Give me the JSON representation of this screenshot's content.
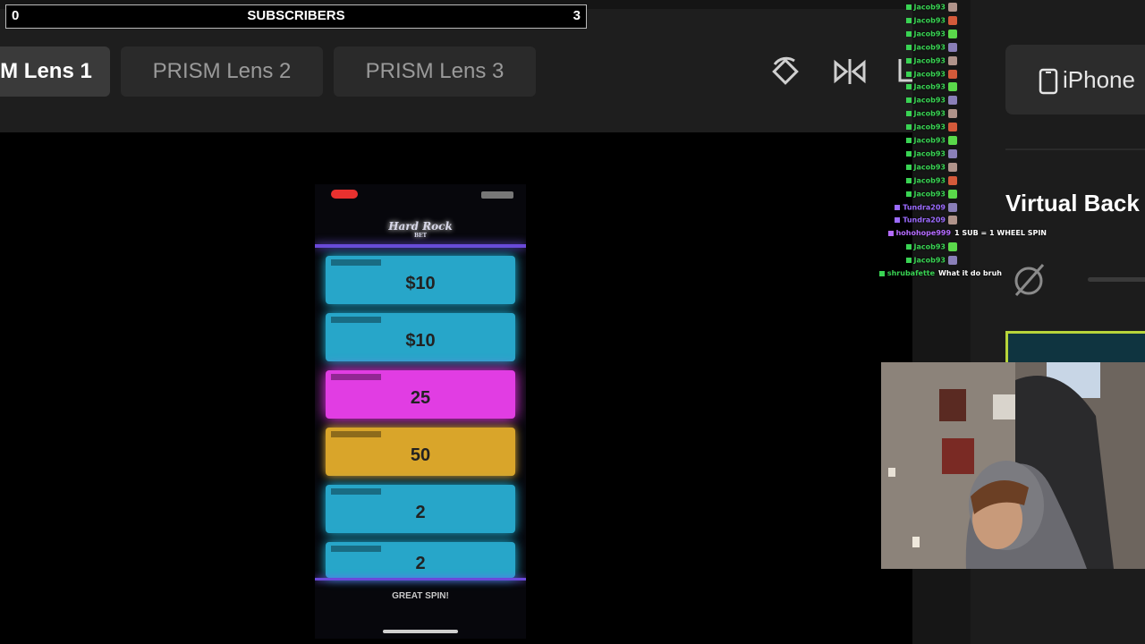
{
  "subscriber_bar": {
    "left_count": "0",
    "title": "SUBSCRIBERS",
    "right_count": "3"
  },
  "lens_tabs": [
    {
      "label": "M Lens 1",
      "active": true
    },
    {
      "label": "PRISM Lens 2",
      "active": false
    },
    {
      "label": "PRISM Lens 3",
      "active": false
    }
  ],
  "toolbar_icons": [
    "rotate-icon",
    "mirror-icon",
    "crop-icon"
  ],
  "right_panel": {
    "device_button": "iPhone",
    "device_icon": "phone-icon",
    "virtual_background_title": "Virtual Back",
    "no-bg-icon": "slashed-circle-icon"
  },
  "phone_screen": {
    "logo": "Hard Rock",
    "logo_sub": "BET",
    "cards": [
      {
        "value": "$10",
        "color": "teal"
      },
      {
        "value": "$10",
        "color": "teal"
      },
      {
        "value": "25",
        "color": "pink"
      },
      {
        "value": "50",
        "color": "gold"
      },
      {
        "value": "2",
        "color": "teal"
      },
      {
        "value": "2",
        "color": "teal"
      }
    ],
    "footer": "GREAT SPIN!"
  },
  "chat": [
    {
      "user": "Jacob93",
      "msg": "",
      "color": "#39d353"
    },
    {
      "user": "Jacob93",
      "msg": "",
      "color": "#39d353"
    },
    {
      "user": "Jacob93",
      "msg": "",
      "color": "#39d353"
    },
    {
      "user": "Jacob93",
      "msg": "",
      "color": "#39d353"
    },
    {
      "user": "Jacob93",
      "msg": "",
      "color": "#39d353"
    },
    {
      "user": "Jacob93",
      "msg": "",
      "color": "#39d353"
    },
    {
      "user": "Jacob93",
      "msg": "",
      "color": "#39d353"
    },
    {
      "user": "Jacob93",
      "msg": "",
      "color": "#39d353"
    },
    {
      "user": "Jacob93",
      "msg": "",
      "color": "#39d353"
    },
    {
      "user": "Jacob93",
      "msg": "",
      "color": "#39d353"
    },
    {
      "user": "Jacob93",
      "msg": "",
      "color": "#39d353"
    },
    {
      "user": "Jacob93",
      "msg": "",
      "color": "#39d353"
    },
    {
      "user": "Jacob93",
      "msg": "",
      "color": "#39d353"
    },
    {
      "user": "Jacob93",
      "msg": "",
      "color": "#39d353"
    },
    {
      "user": "Jacob93",
      "msg": "",
      "color": "#39d353"
    },
    {
      "user": "Tundra209",
      "msg": "",
      "color": "#9c6bff"
    },
    {
      "user": "Tundra209",
      "msg": "",
      "color": "#9c6bff"
    },
    {
      "user": "hohohope999",
      "msg": "1 SUB = 1 WHEEL SPIN",
      "color": "#b46bff"
    },
    {
      "user": "Jacob93",
      "msg": "",
      "color": "#39d353"
    },
    {
      "user": "Jacob93",
      "msg": "",
      "color": "#39d353"
    },
    {
      "user": "shrubafette",
      "msg": "What it do bruh",
      "color": "#39d353"
    }
  ]
}
